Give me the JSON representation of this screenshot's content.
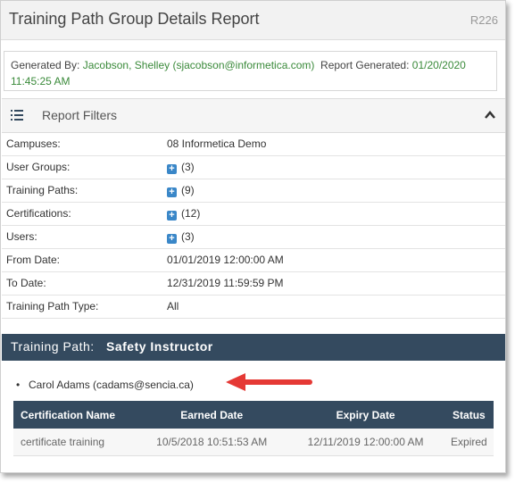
{
  "header": {
    "title": "Training Path Group Details Report",
    "code": "R226"
  },
  "generated": {
    "by_label": "Generated By:",
    "by_value": "Jacobson, Shelley (sjacobson@informetica.com)",
    "date_label": "Report Generated:",
    "date_value": "01/20/2020",
    "time_value": "11:45:25 AM"
  },
  "filters": {
    "title": "Report Filters",
    "icon": "list-icon",
    "toggle_icon": "chevron-up-icon",
    "rows": [
      {
        "label": "Campuses:",
        "value": "08 Informetica Demo",
        "expand": false
      },
      {
        "label": "User Groups:",
        "value": "(3)",
        "expand": true
      },
      {
        "label": "Training Paths:",
        "value": "(9)",
        "expand": true
      },
      {
        "label": "Certifications:",
        "value": "(12)",
        "expand": true
      },
      {
        "label": "Users:",
        "value": "(3)",
        "expand": true
      },
      {
        "label": "From Date:",
        "value": "01/01/2019 12:00:00 AM",
        "expand": false
      },
      {
        "label": "To Date:",
        "value": "12/31/2019 11:59:59 PM",
        "expand": false
      },
      {
        "label": "Training Path Type:",
        "value": "All",
        "expand": false
      }
    ]
  },
  "training_path": {
    "label": "Training Path:",
    "name": "Safety Instructor"
  },
  "user": {
    "name": "Carol Adams (cadams@sencia.ca)"
  },
  "table": {
    "headers": [
      "Certification Name",
      "Earned Date",
      "Expiry Date",
      "Status"
    ],
    "rows": [
      [
        "certificate training",
        "10/5/2018 10:51:53 AM",
        "12/11/2019 12:00:00 AM",
        "Expired"
      ]
    ]
  },
  "colors": {
    "header_bg": "#344a5f",
    "accent_green": "#3a8a3a",
    "arrow": "#e53935",
    "expand_icon": "#3a87c8"
  }
}
